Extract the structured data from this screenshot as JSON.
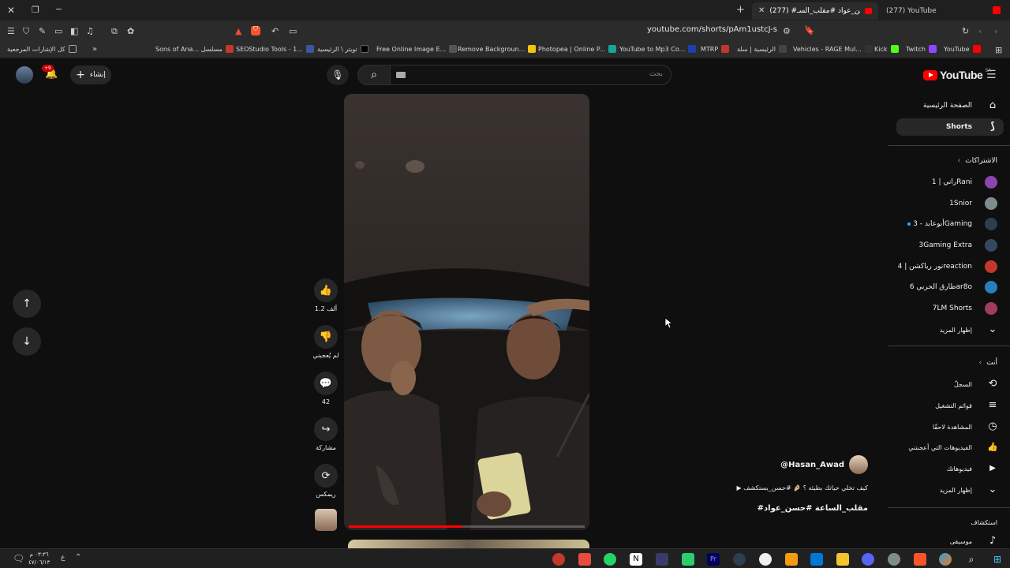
{
  "browser": {
    "tabs": [
      {
        "title": "(277) YouTube",
        "active": false
      },
      {
        "title": "(277) #حسن_عواد #مقلب_السـ",
        "active": true
      }
    ],
    "new_tab": "+",
    "url": "youtube.com/shorts/pAm1ustcJ-s",
    "bookmarks": [
      {
        "label": "كل الإشارات المرجعية",
        "color": "#888888"
      },
      {
        "label": "Sons of Ana... مسلسل",
        "color": "#c0392b"
      },
      {
        "label": "SEOStudio Tools - 1...",
        "color": "#3b5998"
      },
      {
        "label": "تويتر \\ الرئيسية",
        "color": "#000000"
      },
      {
        "label": "Free Online Image E...",
        "color": "#555555"
      },
      {
        "label": "Remove Backgroun...",
        "color": "#f1c40f"
      },
      {
        "label": "Photopea | Online P...",
        "color": "#18a497"
      },
      {
        "label": "YouTube to Mp3 Co...",
        "color": "#1e40af"
      },
      {
        "label": "MTRP",
        "color": "#c0392b"
      },
      {
        "label": "الرئيسية | سلة",
        "color": "#444444"
      },
      {
        "label": "Vehicles - RAGE Mul...",
        "color": "#333333"
      },
      {
        "label": "Kick",
        "color": "#53fc18"
      },
      {
        "label": "Twitch",
        "color": "#9146ff"
      },
      {
        "label": "YouTube",
        "color": "#ff0000"
      }
    ]
  },
  "youtube": {
    "logo_text": "YouTube",
    "logo_region": "SA",
    "search_placeholder": "بحث",
    "create_label": "إنشاء",
    "notifications_badge": "+9",
    "sidebar": {
      "home": "الصفحة الرئيسية",
      "shorts": "Shorts",
      "subscriptions_header": "الاشتراكات",
      "subscriptions": [
        {
          "name": "راني | 1Rani",
          "color": "#8e44ad",
          "dot": false
        },
        {
          "name": "1Snior",
          "color": "#7f8c8d",
          "dot": false
        },
        {
          "name": "أبوعابد - 3Gaming",
          "color": "#2c3e50",
          "dot": true
        },
        {
          "name": "3Gaming Extra",
          "color": "#34495e",
          "dot": false
        },
        {
          "name": "نور رياكشن | 4reaction",
          "color": "#c0392b",
          "dot": false
        },
        {
          "name": "طارق الحربي 6ar8o",
          "color": "#2980b9",
          "dot": false
        },
        {
          "name": "7LM Shorts",
          "color": "#a23b5e",
          "dot": false
        }
      ],
      "show_more": "إظهار المزيد",
      "you_header": "أنت",
      "you_items": [
        {
          "label": "السجلّ",
          "icon": "history-icon",
          "glyph": "⟲"
        },
        {
          "label": "قوائم التشغيل",
          "icon": "playlist-icon",
          "glyph": "≡"
        },
        {
          "label": "المشاهدة لاحقًا",
          "icon": "clock-icon",
          "glyph": "◷"
        },
        {
          "label": "الفيديوهات التي أعجبتني",
          "icon": "thumb-up-icon",
          "glyph": "👍"
        },
        {
          "label": "فيديوهاتك",
          "icon": "video-icon",
          "glyph": "▶"
        },
        {
          "label": "إظهار المزيد",
          "icon": "chevron-down-icon",
          "glyph": "⌄"
        }
      ],
      "explore_header": "استكشاف",
      "explore_items": [
        {
          "label": "موسيقى",
          "icon": "music-icon",
          "glyph": "♪"
        }
      ]
    },
    "actions": {
      "like_count": "1.2 ألف",
      "dislike_label": "لم يُعجبني",
      "comments_count": "42",
      "share_label": "مشاركة",
      "remix_label": "ريمكس"
    },
    "short": {
      "channel": "@Hasan_Awad",
      "description": "▶ كيف تخلي حياتك بطيئه ؟ 🤌🏼 #حسن_يستكشف",
      "hashtags": "#مقلب_الساعة #حسن_عواد",
      "progress": 0.48
    }
  },
  "taskbar": {
    "clock_time": "٠٣:٣٦ م",
    "clock_date": "٤٧/٠٦/١٣",
    "lang": "ع"
  }
}
